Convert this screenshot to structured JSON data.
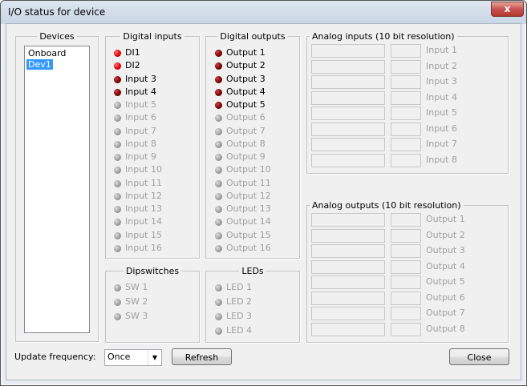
{
  "window": {
    "title": "I/O status for device",
    "close_glyph": "x"
  },
  "devices": {
    "legend": "Devices",
    "items": [
      "Onboard",
      "Dev1"
    ],
    "selected": 1
  },
  "digital_inputs": {
    "legend": "Digital inputs",
    "items": [
      {
        "label": "DI1",
        "state": "on"
      },
      {
        "label": "DI2",
        "state": "on"
      },
      {
        "label": "Input 3",
        "state": "dark"
      },
      {
        "label": "Input 4",
        "state": "dark"
      },
      {
        "label": "Input 5",
        "state": "off"
      },
      {
        "label": "Input 6",
        "state": "off"
      },
      {
        "label": "Input 7",
        "state": "off"
      },
      {
        "label": "Input 8",
        "state": "off"
      },
      {
        "label": "Input 9",
        "state": "off"
      },
      {
        "label": "Input 10",
        "state": "off"
      },
      {
        "label": "Input 11",
        "state": "off"
      },
      {
        "label": "Input 12",
        "state": "off"
      },
      {
        "label": "Input 13",
        "state": "off"
      },
      {
        "label": "Input 14",
        "state": "off"
      },
      {
        "label": "Input 15",
        "state": "off"
      },
      {
        "label": "Input 16",
        "state": "off"
      }
    ]
  },
  "digital_outputs": {
    "legend": "Digital outputs",
    "items": [
      {
        "label": "Output 1",
        "state": "dark"
      },
      {
        "label": "Output 2",
        "state": "dark"
      },
      {
        "label": "Output 3",
        "state": "dark"
      },
      {
        "label": "Output 4",
        "state": "dark"
      },
      {
        "label": "Output 5",
        "state": "dark"
      },
      {
        "label": "Output 6",
        "state": "off"
      },
      {
        "label": "Output 7",
        "state": "off"
      },
      {
        "label": "Output 8",
        "state": "off"
      },
      {
        "label": "Output 9",
        "state": "off"
      },
      {
        "label": "Output 10",
        "state": "off"
      },
      {
        "label": "Output 11",
        "state": "off"
      },
      {
        "label": "Output 12",
        "state": "off"
      },
      {
        "label": "Output 13",
        "state": "off"
      },
      {
        "label": "Output 14",
        "state": "off"
      },
      {
        "label": "Output 15",
        "state": "off"
      },
      {
        "label": "Output 16",
        "state": "off"
      }
    ]
  },
  "dipswitches": {
    "legend": "Dipswitches",
    "items": [
      {
        "label": "SW 1",
        "state": "off"
      },
      {
        "label": "SW 2",
        "state": "off"
      },
      {
        "label": "SW 3",
        "state": "off"
      }
    ]
  },
  "leds": {
    "legend": "LEDs",
    "items": [
      {
        "label": "LED 1",
        "state": "off"
      },
      {
        "label": "LED 2",
        "state": "off"
      },
      {
        "label": "LED 3",
        "state": "off"
      },
      {
        "label": "LED 4",
        "state": "off"
      }
    ]
  },
  "analog_inputs": {
    "legend": "Analog inputs (10 bit resolution)",
    "labels": [
      "Input 1",
      "Input 2",
      "Input 3",
      "Input 4",
      "Input 5",
      "Input 6",
      "Input 7",
      "Input 8"
    ]
  },
  "analog_outputs": {
    "legend": "Analog outputs (10 bit resolution)",
    "labels": [
      "Output 1",
      "Output 2",
      "Output 3",
      "Output 4",
      "Output 5",
      "Output 6",
      "Output 7",
      "Output 8"
    ]
  },
  "footer": {
    "update_label": "Update frequency:",
    "frequency_value": "Once",
    "refresh_label": "Refresh",
    "close_label": "Close"
  },
  "colors": {
    "led_on": "#e00000",
    "led_dark": "#7a0000",
    "led_off": "#a0a0a0",
    "selection": "#3399ff"
  }
}
